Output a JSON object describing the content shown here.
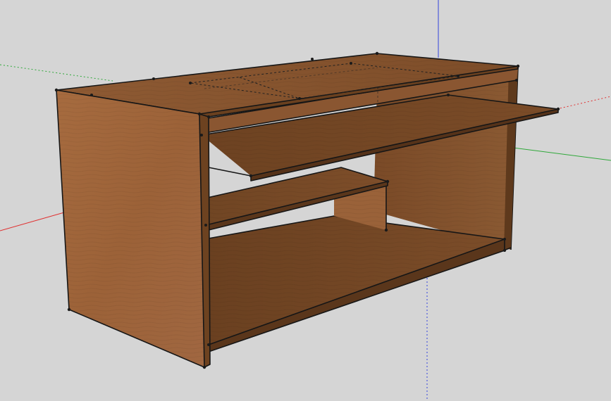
{
  "scene": {
    "model_name": "desk",
    "background_color": "#d5d5d5",
    "axis_colors": {
      "x": "#e03030",
      "y": "#2fa83a",
      "z": "#3344dd"
    },
    "wood_colors": {
      "light": "#a2683d",
      "mid": "#8f5a32",
      "dark": "#6e4322",
      "shadow": "#5a361b"
    },
    "edge_color": "#161616",
    "hidden_edges": "dashed"
  }
}
